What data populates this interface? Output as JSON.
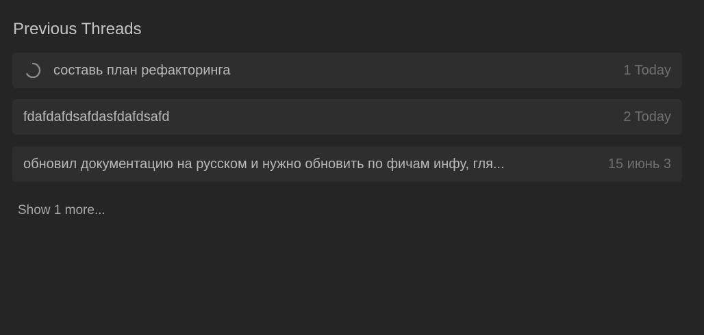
{
  "section": {
    "title": "Previous Threads"
  },
  "threads": [
    {
      "title": "составь план рефакторинга",
      "meta": "1 Today",
      "icon": "loading-spinner-icon"
    },
    {
      "title": "fdafdafdsafdasfdafdsafd",
      "meta": "2 Today"
    },
    {
      "title": "обновил документацию на русском и нужно обновить по фичам инфу, гля...",
      "meta": "15 июнь 3"
    }
  ],
  "show_more_label": "Show 1 more...",
  "colors": {
    "background": "#252525",
    "row_background": "#2e2e2e",
    "primary_text": "#b8b8b8",
    "meta_text": "#6f6f6f"
  }
}
